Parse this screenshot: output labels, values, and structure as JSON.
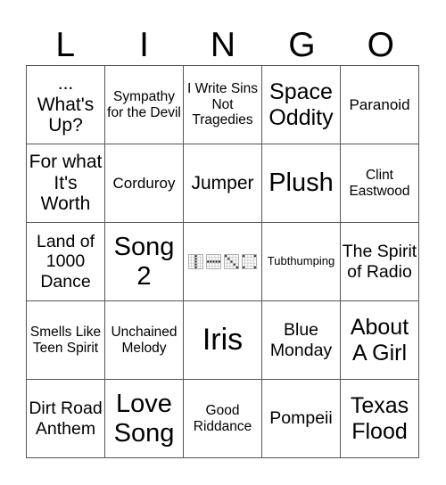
{
  "title_letters": [
    "L",
    "I",
    "N",
    "G",
    "O"
  ],
  "cells": [
    {
      "text": "... What's Up?",
      "size": "s21"
    },
    {
      "text": "Sympathy for the Devil",
      "size": "s15"
    },
    {
      "text": "I Write Sins Not Tragedies",
      "size": "s15"
    },
    {
      "text": "Space Oddity",
      "size": "s25"
    },
    {
      "text": "Paranoid",
      "size": "s17"
    },
    {
      "text": "For what It's Worth",
      "size": "s21"
    },
    {
      "text": "Corduroy",
      "size": "s17"
    },
    {
      "text": "Jumper",
      "size": "s21"
    },
    {
      "text": "Plush",
      "size": "s28"
    },
    {
      "text": "Clint Eastwood",
      "size": "s15"
    },
    {
      "text": "Land of 1000 Dance",
      "size": "s19"
    },
    {
      "text": "Song 2",
      "size": "s28"
    },
    {
      "text": "",
      "size": "free",
      "free_space": true,
      "patterns": [
        "vertical-line-pattern",
        "horizontal-line-pattern",
        "diagonal-pattern",
        "four-corners-pattern"
      ]
    },
    {
      "text": "Tubthumping",
      "size": "s13"
    },
    {
      "text": "The Spirit of Radio",
      "size": "s19"
    },
    {
      "text": "Smells Like Teen Spirit",
      "size": "s15"
    },
    {
      "text": "Unchained Melody",
      "size": "s15"
    },
    {
      "text": "Iris",
      "size": "s33"
    },
    {
      "text": "Blue Monday",
      "size": "s19"
    },
    {
      "text": "About A Girl",
      "size": "s25"
    },
    {
      "text": "Dirt Road Anthem",
      "size": "s19"
    },
    {
      "text": "Love Song",
      "size": "s28"
    },
    {
      "text": "Good Riddance",
      "size": "s15"
    },
    {
      "text": "Pompeii",
      "size": "s19"
    },
    {
      "text": "Texas Flood",
      "size": "s25"
    }
  ]
}
